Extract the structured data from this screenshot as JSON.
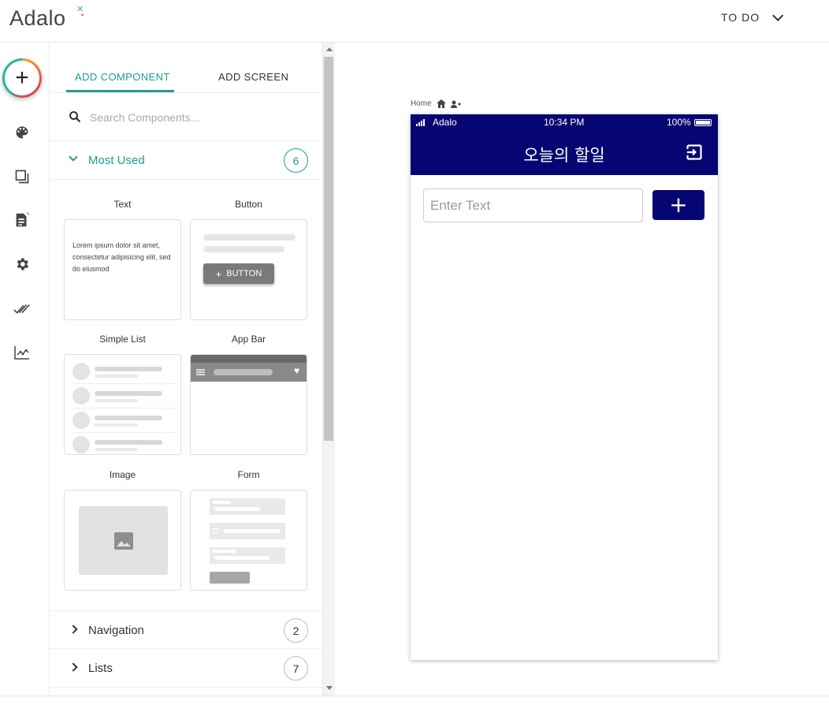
{
  "header": {
    "logo_text": "Adalo",
    "app_name": "TO DO"
  },
  "rail": {
    "items": [
      {
        "name": "add-icon",
        "label": "+"
      },
      {
        "name": "palette-icon"
      },
      {
        "name": "screens-icon"
      },
      {
        "name": "database-icon"
      },
      {
        "name": "gear-icon"
      },
      {
        "name": "publish-check-icon"
      },
      {
        "name": "analytics-icon"
      }
    ]
  },
  "panel": {
    "tabs": [
      {
        "label": "ADD COMPONENT",
        "active": true
      },
      {
        "label": "ADD SCREEN",
        "active": false
      }
    ],
    "search_placeholder": "Search Components...",
    "sections": [
      {
        "label": "Most Used",
        "count": "6",
        "expanded": true
      },
      {
        "label": "Navigation",
        "count": "2",
        "expanded": false
      },
      {
        "label": "Lists",
        "count": "7",
        "expanded": false
      }
    ],
    "components": [
      {
        "label": "Text",
        "preview_text": "Lorem ipsum dolor sit amet, consectetur adipisicing elit, sed do eiusmod"
      },
      {
        "label": "Button",
        "preview_text": "BUTTON"
      },
      {
        "label": "Simple List"
      },
      {
        "label": "App Bar"
      },
      {
        "label": "Image"
      },
      {
        "label": "Form"
      }
    ]
  },
  "canvas": {
    "screen_name": "Home",
    "phone": {
      "carrier": "Adalo",
      "time": "10:34 PM",
      "battery": "100%",
      "appbar_title": "오늘의 할일",
      "input_placeholder": "Enter Text",
      "add_button_label": "+"
    }
  },
  "colors": {
    "accent": "#1f9d8c",
    "app_navy": "#060672"
  }
}
